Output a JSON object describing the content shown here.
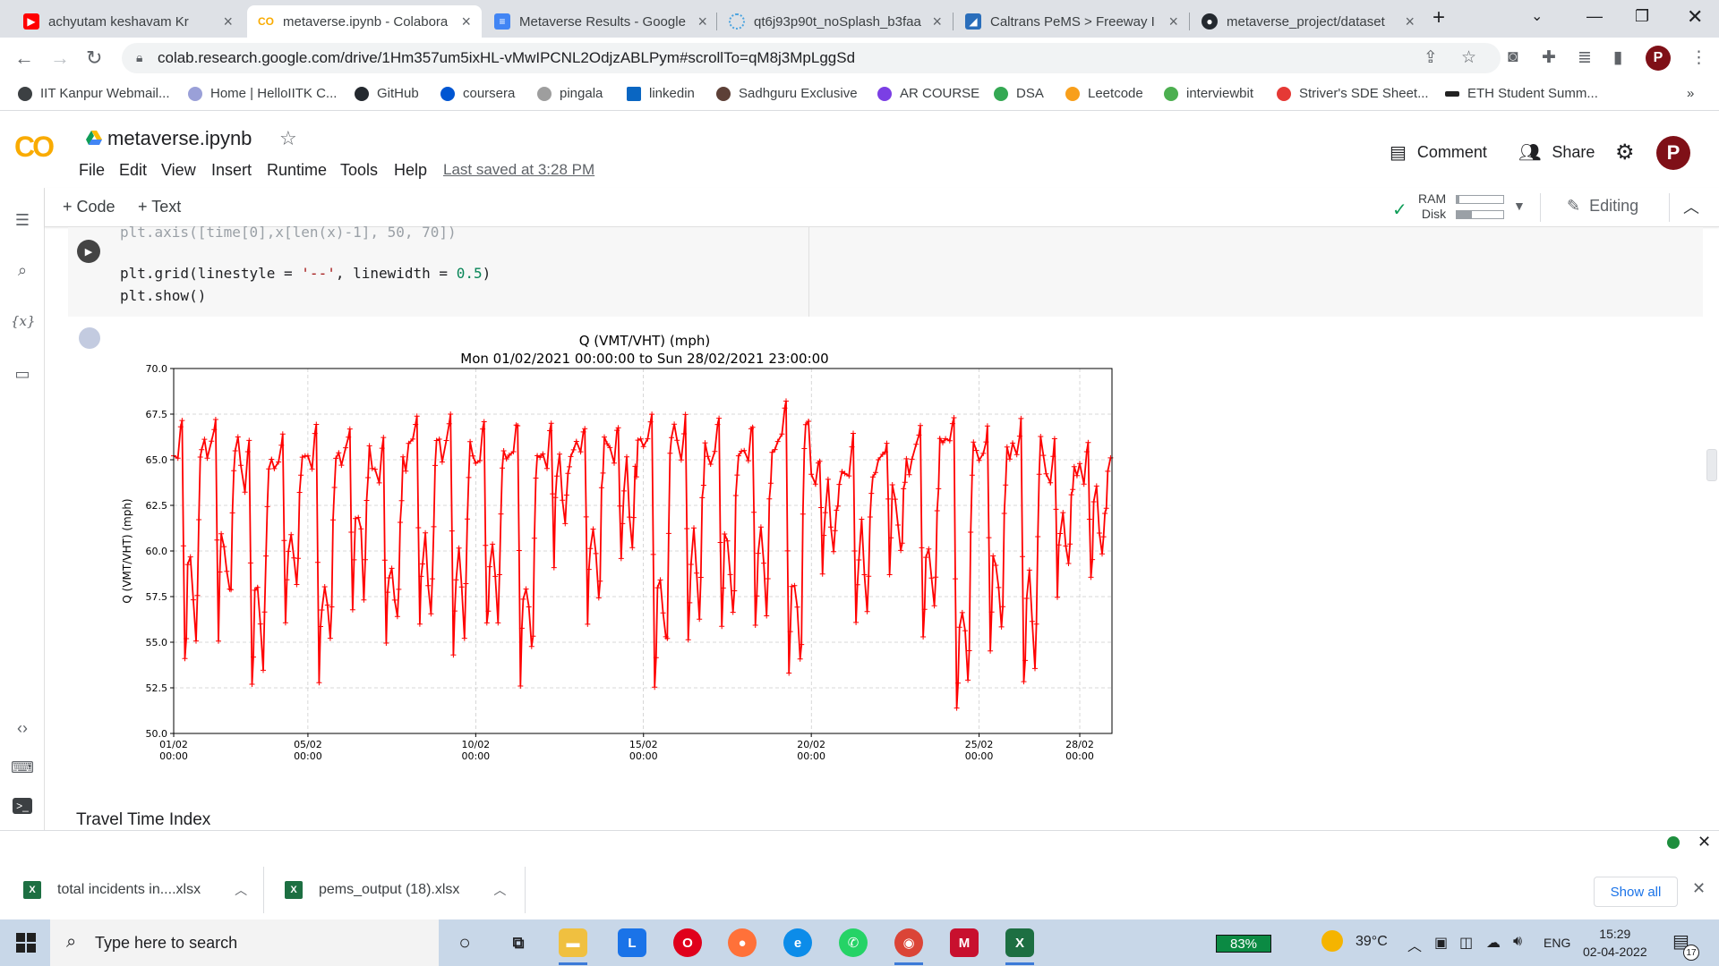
{
  "browser": {
    "tabs": [
      {
        "title": "achyutam keshavam Kr",
        "icon": "youtube-icon",
        "color": "#ff0000"
      },
      {
        "title": "metaverse.ipynb - Colabora",
        "icon": "colab-icon",
        "color": "#f9ab00",
        "active": true
      },
      {
        "title": "Metaverse Results - Google",
        "icon": "docs-icon",
        "color": "#4285f4"
      },
      {
        "title": "qt6j93p90t_noSplash_b3faa",
        "icon": "loading-icon",
        "color": "#4aa3df"
      },
      {
        "title": "Caltrans PeMS > Freeway I",
        "icon": "caltrans-icon",
        "color": "#2a6ebb"
      },
      {
        "title": "metaverse_project/dataset",
        "icon": "github-icon",
        "color": "#24292f"
      }
    ],
    "new_tab": "+",
    "url": "colab.research.google.com/drive/1Hm357um5ixHL-vMwIPCNL2OdjzABLPym#scrollTo=qM8j3MpLggSd",
    "profile_initial": "P"
  },
  "bookmarks": [
    {
      "label": "IIT Kanpur Webmail...",
      "color": "#3c4043"
    },
    {
      "label": "Home | HelloIITK C...",
      "color": "#9aa0d8"
    },
    {
      "label": "GitHub",
      "color": "#24292f"
    },
    {
      "label": "coursera",
      "color": "#0056d2"
    },
    {
      "label": "pingala",
      "color": "#9e9e9e"
    },
    {
      "label": "linkedin",
      "color": "#0a66c2"
    },
    {
      "label": "Sadhguru Exclusive",
      "color": "#5d4037"
    },
    {
      "label": "AR COURSE",
      "color": "#7b3fe4"
    },
    {
      "label": "DSA",
      "color": "#34a853"
    },
    {
      "label": "Leetcode",
      "color": "#f89f1b"
    },
    {
      "label": "interviewbit",
      "color": "#4caf50"
    },
    {
      "label": "Striver's SDE Sheet...",
      "color": "#e53935"
    },
    {
      "label": "ETH Student Summ...",
      "color": "#222222"
    }
  ],
  "bookmarks_more": "»",
  "colab": {
    "logo": "CO",
    "title": "metaverse.ipynb",
    "menu": [
      "File",
      "Edit",
      "View",
      "Insert",
      "Runtime",
      "Tools",
      "Help"
    ],
    "last_saved": "Last saved at 3:28 PM",
    "comment": "Comment",
    "share": "Share",
    "add_code": "+ Code",
    "add_text": "+ Text",
    "ram": "RAM",
    "disk": "Disk",
    "editing": "Editing"
  },
  "code_lines": {
    "line1": "plt.axis([time[0],x[len(x)-1], 50, 70])",
    "line2a": "plt.grid(linestyle = ",
    "line2b": "'--'",
    "line2c": ", linewidth = ",
    "line2d": "0.5",
    "line2e": ")",
    "line3": "plt.show()"
  },
  "chart_data": {
    "type": "line",
    "title": "Q (VMT/VHT) (mph)",
    "subtitle": "Mon 01/02/2021 00:00:00 to Sun 28/02/2021 23:00:00",
    "xlabel": "",
    "ylabel": "Q (VMT/VHT) (mph)",
    "ylim": [
      50,
      70
    ],
    "xlim_days": [
      0,
      27.96
    ],
    "yticks": [
      "50.0",
      "52.5",
      "55.0",
      "57.5",
      "60.0",
      "62.5",
      "65.0",
      "67.5",
      "70.0"
    ],
    "xticks": [
      {
        "day": 0,
        "l1": "01/02",
        "l2": "00:00"
      },
      {
        "day": 4,
        "l1": "05/02",
        "l2": "00:00"
      },
      {
        "day": 9,
        "l1": "10/02",
        "l2": "00:00"
      },
      {
        "day": 14,
        "l1": "15/02",
        "l2": "00:00"
      },
      {
        "day": 19,
        "l1": "20/02",
        "l2": "00:00"
      },
      {
        "day": 24,
        "l1": "25/02",
        "l2": "00:00"
      },
      {
        "day": 27,
        "l1": "28/02",
        "l2": "00:00"
      }
    ],
    "grid": true,
    "color": "#ff0000",
    "marker": "+",
    "daily_profile": {
      "note": "hourly series: daytime ~65-67.5 mph with sharp peak-hour dips",
      "day_highs": [
        67.3,
        67.5,
        66.2,
        66.8,
        67.2,
        66.9,
        66.5,
        67.4,
        67.5,
        67.3,
        67.4,
        67.5,
        67.3,
        67.2,
        67.8,
        67.5,
        67.4,
        67.2,
        68.3,
        65.5,
        66.5,
        66.5,
        67.3,
        67.5,
        67.0,
        67.3,
        66.2,
        66.3
      ],
      "day_lows": [
        53.5,
        55.0,
        52.3,
        55.8,
        52.5,
        56.3,
        54.0,
        55.0,
        54.2,
        55.0,
        52.0,
        59.0,
        55.8,
        58.5,
        52.5,
        54.8,
        55.0,
        55.2,
        52.2,
        58.0,
        55.5,
        57.8,
        55.0,
        51.0,
        54.0,
        52.5,
        56.5,
        57.8
      ]
    }
  },
  "travel_time_label": "Travel Time Index",
  "downloads": [
    {
      "name": "total incidents in....xlsx"
    },
    {
      "name": "pems_output (18).xlsx"
    }
  ],
  "show_all": "Show all",
  "taskbar": {
    "search_placeholder": "Type here to search",
    "battery": "83%",
    "temp": "39°C",
    "lang": "ENG",
    "time": "15:29",
    "date": "02-04-2022",
    "notifications": "17"
  }
}
